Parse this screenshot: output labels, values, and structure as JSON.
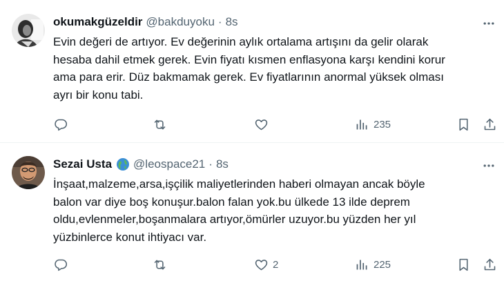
{
  "tweets": [
    {
      "display_name": "okumakgüzeldir",
      "handle": "@bakduyoku",
      "separator": "·",
      "time": "8s",
      "has_globe": false,
      "text_lines": [
        "Evin değeri de artıyor. Ev değerinin aylık ortalama artışını da gelir olarak",
        "hesaba dahil etmek gerek. Evin fiyatı kısmen enflasyona karşı kendini korur",
        "ama para erir. Düz bakmamak gerek. Ev fiyatlarının anormal yüksek olması",
        "ayrı bir konu tabi."
      ],
      "like_count": "",
      "view_count": "235"
    },
    {
      "display_name": "Sezai Usta",
      "handle": "@leospace21",
      "separator": "·",
      "time": "8s",
      "has_globe": true,
      "text_lines": [
        "İnşaat,malzeme,arsa,işçilik maliyetlerinden haberi olmayan ancak böyle",
        "balon var diye boş konuşur.balon falan yok.bu ülkede 13 ilde deprem",
        "oldu,evlenmeler,boşanmalara artıyor,ömürler uzuyor.bu yüzden her yıl",
        "yüzbinlerce konut ihtiyacı var."
      ],
      "like_count": "2",
      "view_count": "225"
    }
  ],
  "icons": {
    "more": "more-horizontal-icon",
    "reply": "reply-icon",
    "retweet": "retweet-icon",
    "like": "heart-icon",
    "views": "views-icon",
    "bookmark": "bookmark-icon",
    "share": "share-icon",
    "globe": "globe-emoji-icon"
  },
  "colors": {
    "text": "#0f1419",
    "secondary": "#536471",
    "divider": "#eff3f4"
  }
}
